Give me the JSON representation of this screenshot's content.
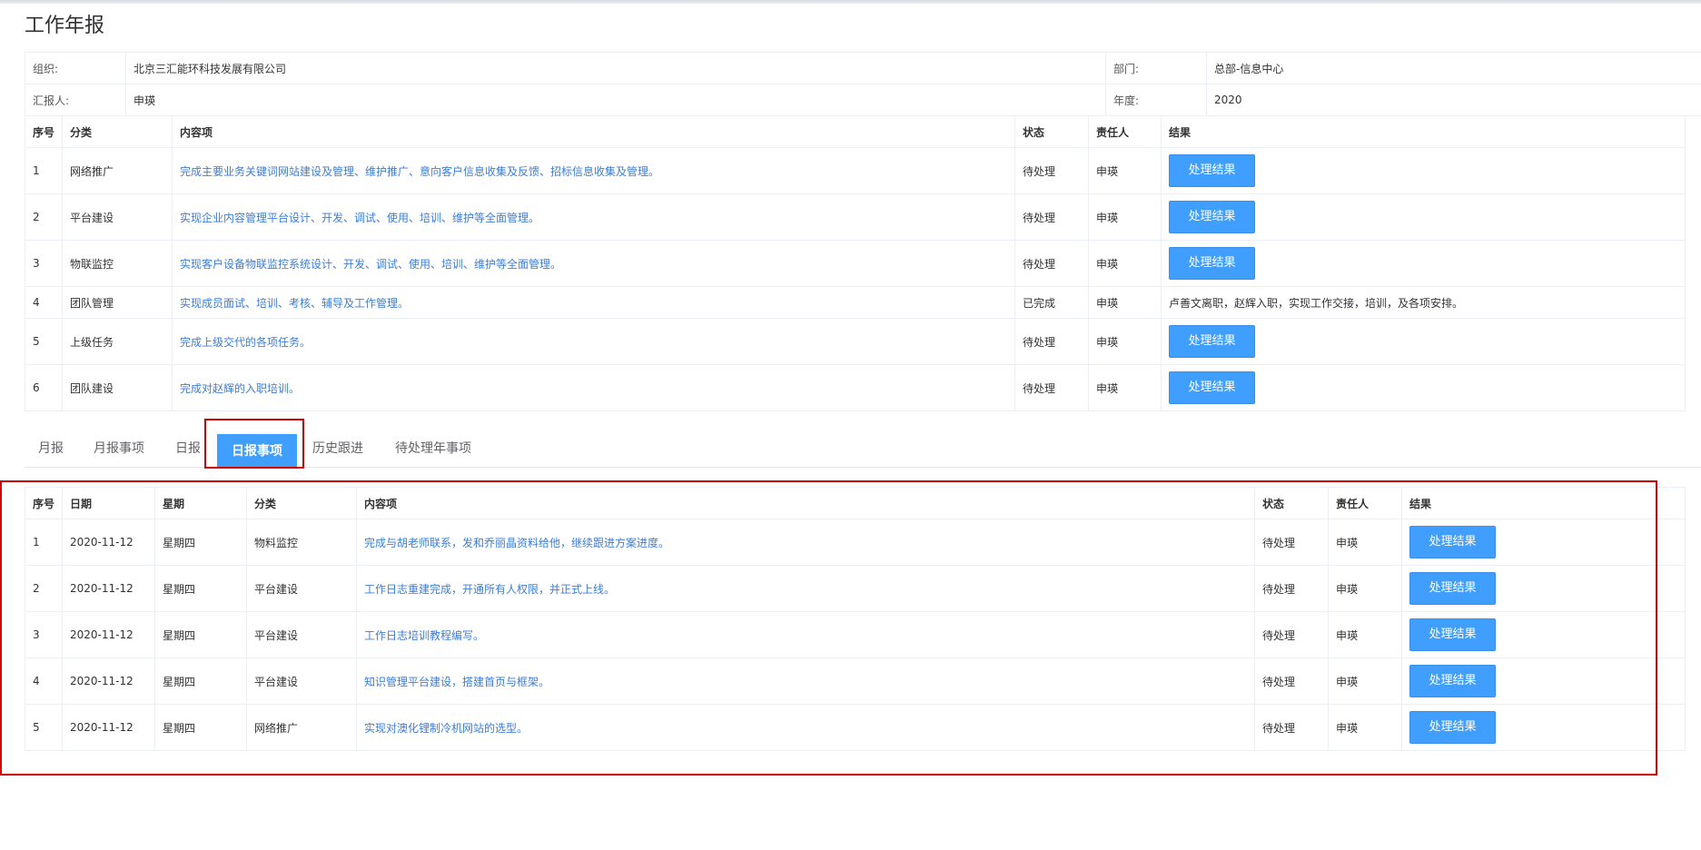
{
  "page_title": "工作年报",
  "info": {
    "org_label": "组织:",
    "org_value": "北京三汇能环科技发展有限公司",
    "dept_label": "部门:",
    "dept_value": "总部-信息中心",
    "reporter_label": "汇报人:",
    "reporter_value": "申瑛",
    "year_label": "年度:",
    "year_value": "2020"
  },
  "main_table": {
    "headers": [
      "序号",
      "分类",
      "内容项",
      "状态",
      "责任人",
      "结果"
    ],
    "rows": [
      {
        "no": "1",
        "category": "网络推广",
        "content": "完成主要业务关键词网站建设及管理、维护推广、意向客户信息收集及反馈、招标信息收集及管理。",
        "status": "待处理",
        "owner": "申瑛",
        "result": "处理结果"
      },
      {
        "no": "2",
        "category": "平台建设",
        "content": "实现企业内容管理平台设计、开发、调试、使用、培训、维护等全面管理。",
        "status": "待处理",
        "owner": "申瑛",
        "result": "处理结果"
      },
      {
        "no": "3",
        "category": "物联监控",
        "content": "实现客户设备物联监控系统设计、开发、调试、使用、培训、维护等全面管理。",
        "status": "待处理",
        "owner": "申瑛",
        "result": "处理结果"
      },
      {
        "no": "4",
        "category": "团队管理",
        "content": "实现成员面试、培训、考核、辅导及工作管理。",
        "status": "已完成",
        "owner": "申瑛",
        "result": "卢善文离职，赵辉入职，实现工作交接，培训，及各项安排。"
      },
      {
        "no": "5",
        "category": "上级任务",
        "content": "完成上级交代的各项任务。",
        "status": "待处理",
        "owner": "申瑛",
        "result": "处理结果"
      },
      {
        "no": "6",
        "category": "团队建设",
        "content": "完成对赵辉的入职培训。",
        "status": "待处理",
        "owner": "申瑛",
        "result": "处理结果"
      }
    ]
  },
  "tabs": [
    {
      "label": "月报"
    },
    {
      "label": "月报事项"
    },
    {
      "label": "日报"
    },
    {
      "label": "日报事项"
    },
    {
      "label": "历史跟进"
    },
    {
      "label": "待处理年事项"
    }
  ],
  "daily_table": {
    "headers": [
      "序号",
      "日期",
      "星期",
      "分类",
      "内容项",
      "状态",
      "责任人",
      "结果"
    ],
    "rows": [
      {
        "no": "1",
        "date": "2020-11-12",
        "weekday": "星期四",
        "category": "物料监控",
        "content": "完成与胡老师联系，发和乔丽晶资料给他，继续跟进方案进度。",
        "status": "待处理",
        "owner": "申瑛",
        "result": "处理结果"
      },
      {
        "no": "2",
        "date": "2020-11-12",
        "weekday": "星期四",
        "category": "平台建设",
        "content": "工作日志重建完成，开通所有人权限，并正式上线。",
        "status": "待处理",
        "owner": "申瑛",
        "result": "处理结果"
      },
      {
        "no": "3",
        "date": "2020-11-12",
        "weekday": "星期四",
        "category": "平台建设",
        "content": "工作日志培训教程编写。",
        "status": "待处理",
        "owner": "申瑛",
        "result": "处理结果"
      },
      {
        "no": "4",
        "date": "2020-11-12",
        "weekday": "星期四",
        "category": "平台建设",
        "content": "知识管理平台建设，搭建首页与框架。",
        "status": "待处理",
        "owner": "申瑛",
        "result": "处理结果"
      },
      {
        "no": "5",
        "date": "2020-11-12",
        "weekday": "星期四",
        "category": "网络推广",
        "content": "实现对澳化锂制冷机网站的选型。",
        "status": "待处理",
        "owner": "申瑛",
        "result": "处理结果"
      }
    ]
  }
}
